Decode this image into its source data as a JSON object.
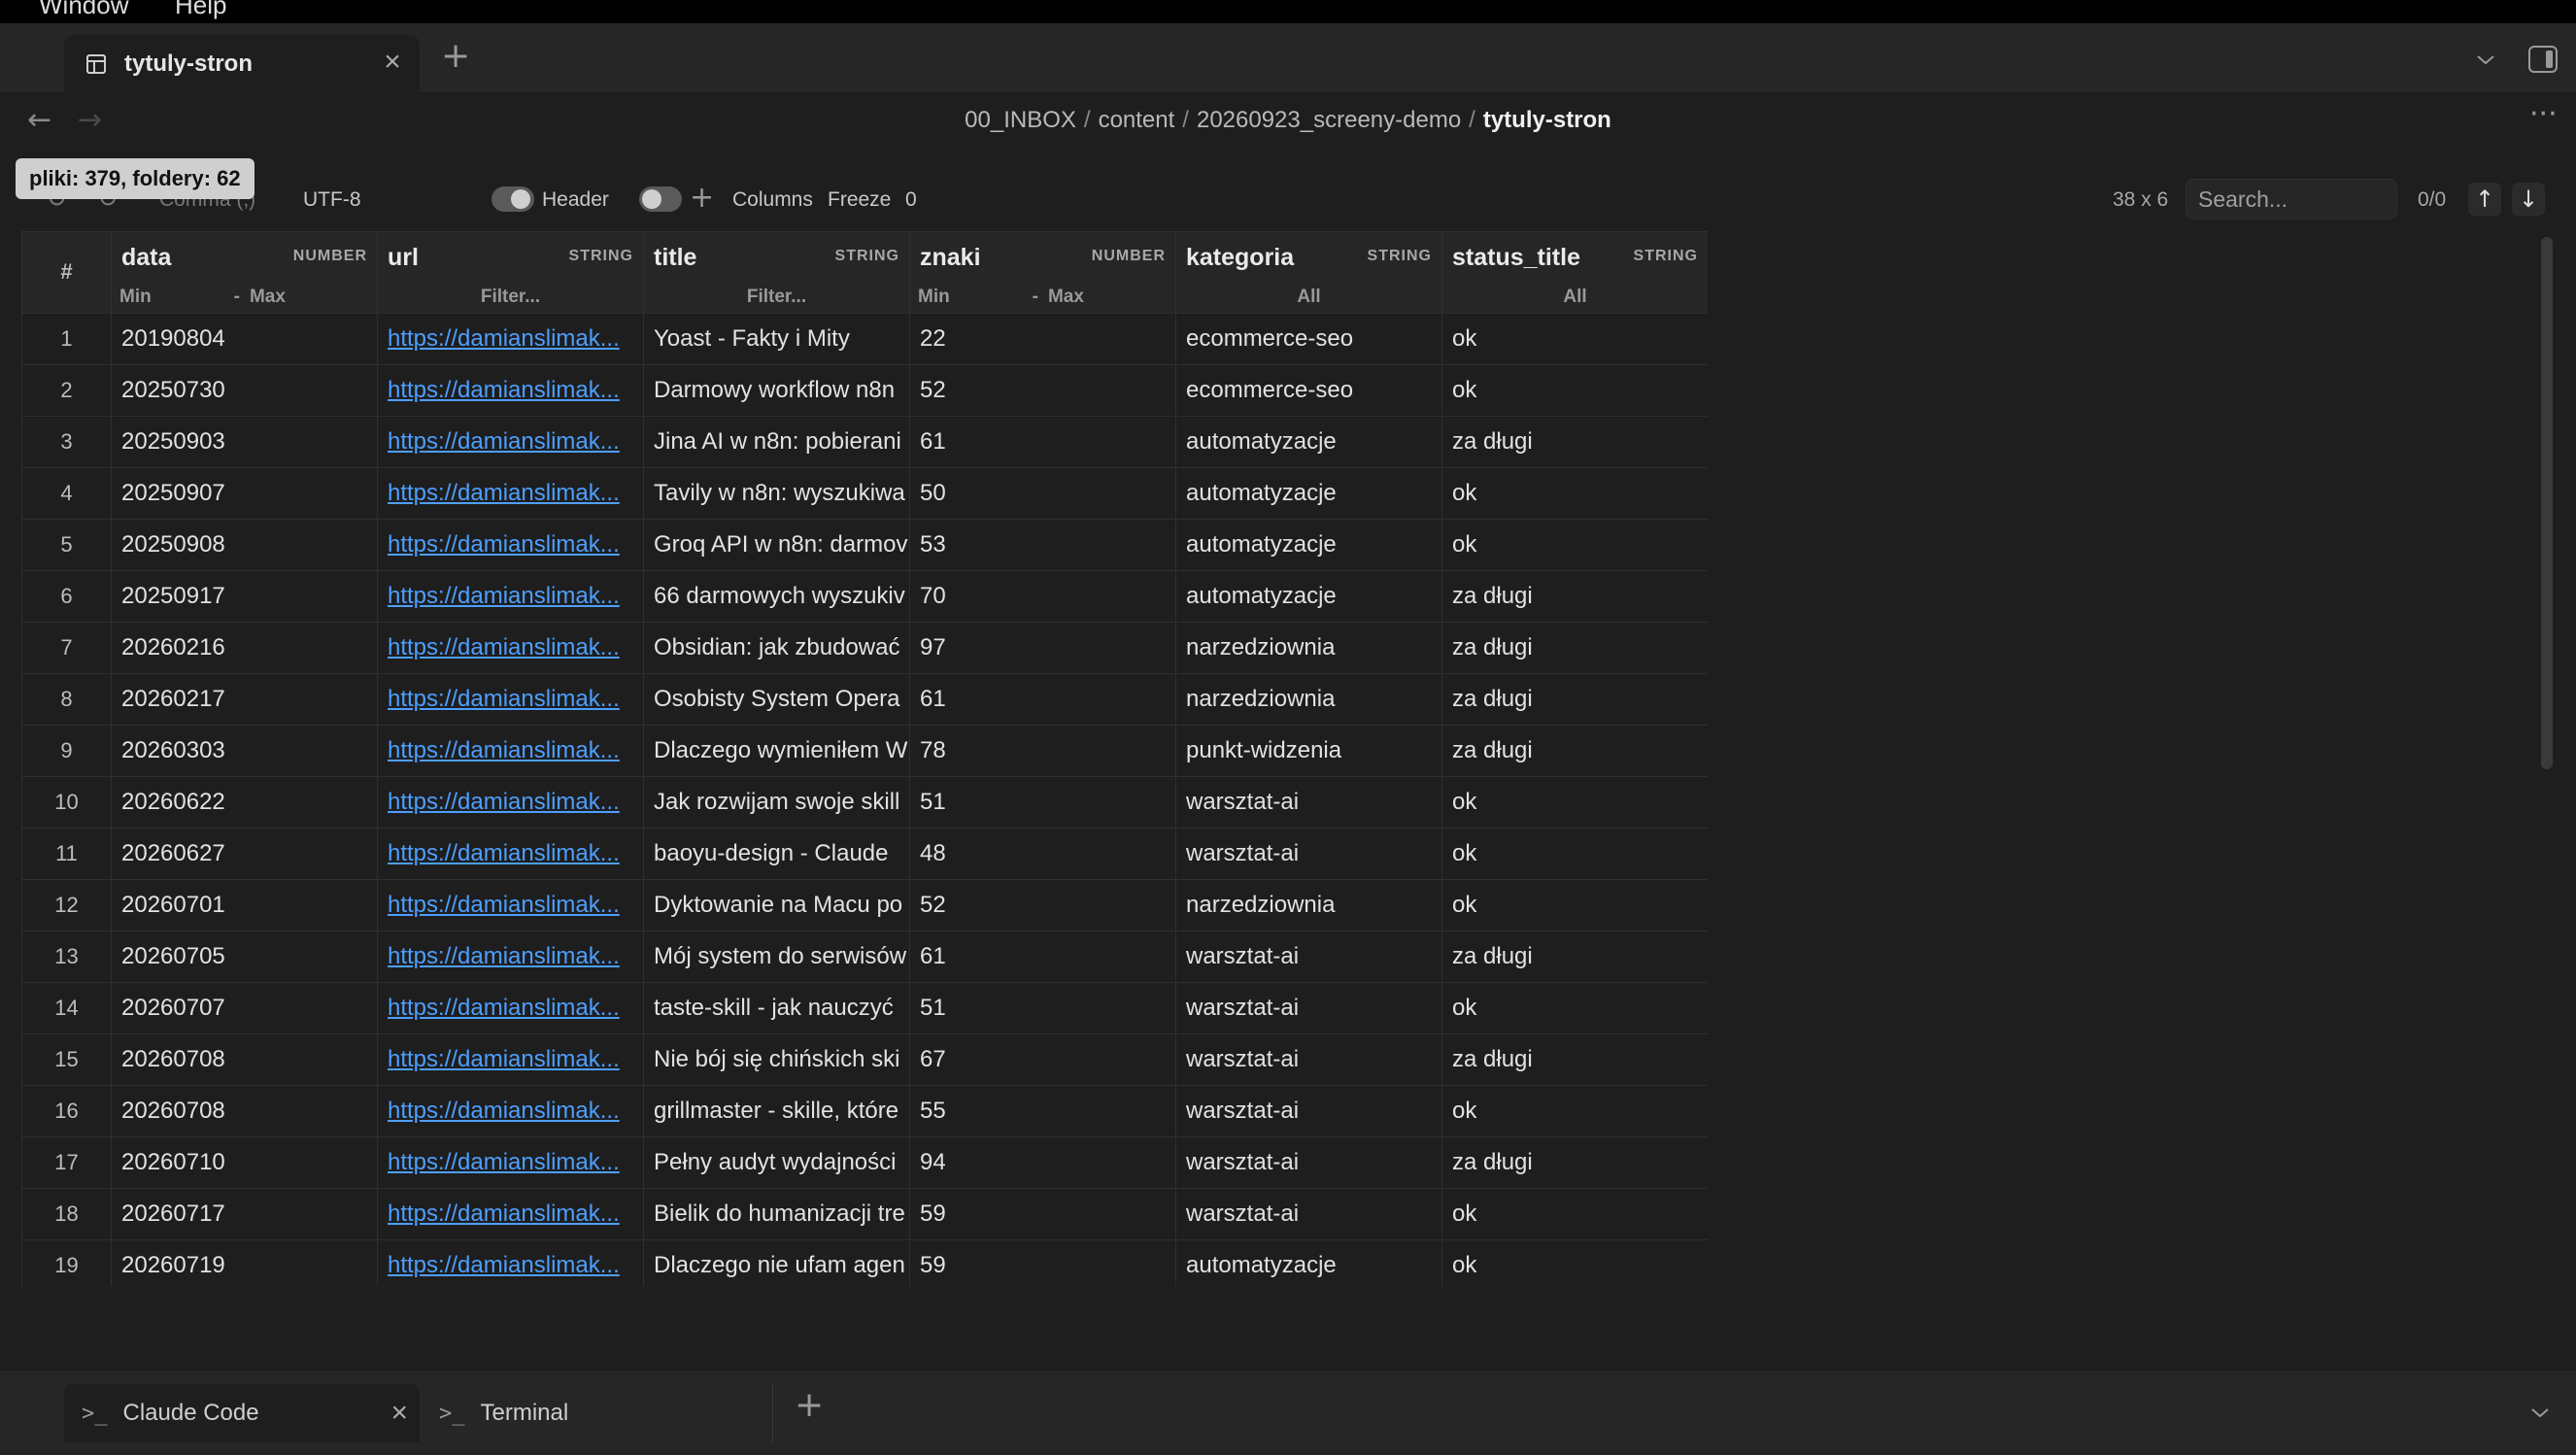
{
  "menubar": {
    "items": [
      "Window",
      "Help"
    ]
  },
  "tabs": [
    {
      "label": "tytuly-stron",
      "active": true
    }
  ],
  "breadcrumb": {
    "parts": [
      "00_INBOX",
      "content",
      "20260923_screeny-demo"
    ],
    "current": "tytuly-stron",
    "separator": "/"
  },
  "tooltip": {
    "text": "pliki: 379, foldery: 62"
  },
  "toolbar": {
    "delimiter": "Comma (,)",
    "encoding": "UTF-8",
    "header_label": "Header",
    "columns_label": "Columns",
    "freeze_label": "Freeze",
    "freeze_value": "0",
    "dimensions": "38 x 6",
    "search_placeholder": "Search...",
    "match_count": "0/0"
  },
  "table": {
    "index_header": "#",
    "columns": [
      {
        "name": "data",
        "type": "NUMBER",
        "filter": "range",
        "min": "Min",
        "dash": "-",
        "max": "Max"
      },
      {
        "name": "url",
        "type": "STRING",
        "filter": "text",
        "placeholder": "Filter..."
      },
      {
        "name": "title",
        "type": "STRING",
        "filter": "text",
        "placeholder": "Filter..."
      },
      {
        "name": "znaki",
        "type": "NUMBER",
        "filter": "range",
        "min": "Min",
        "dash": "-",
        "max": "Max"
      },
      {
        "name": "kategoria",
        "type": "STRING",
        "filter": "select",
        "value": "All"
      },
      {
        "name": "status_title",
        "type": "STRING",
        "filter": "select",
        "value": "All"
      }
    ],
    "rows": [
      {
        "i": "1",
        "data": "20190804",
        "url": "https://damianslimak...",
        "title": "Yoast - Fakty i Mity",
        "znaki": "22",
        "kategoria": "ecommerce-seo",
        "status": "ok"
      },
      {
        "i": "2",
        "data": "20250730",
        "url": "https://damianslimak...",
        "title": "Darmowy workflow n8n",
        "znaki": "52",
        "kategoria": "ecommerce-seo",
        "status": "ok"
      },
      {
        "i": "3",
        "data": "20250903",
        "url": "https://damianslimak...",
        "title": "Jina AI w n8n: pobierani",
        "znaki": "61",
        "kategoria": "automatyzacje",
        "status": "za długi"
      },
      {
        "i": "4",
        "data": "20250907",
        "url": "https://damianslimak...",
        "title": "Tavily w n8n: wyszukiwa",
        "znaki": "50",
        "kategoria": "automatyzacje",
        "status": "ok"
      },
      {
        "i": "5",
        "data": "20250908",
        "url": "https://damianslimak...",
        "title": "Groq API w n8n: darmov",
        "znaki": "53",
        "kategoria": "automatyzacje",
        "status": "ok"
      },
      {
        "i": "6",
        "data": "20250917",
        "url": "https://damianslimak...",
        "title": "66 darmowych wyszukiv",
        "znaki": "70",
        "kategoria": "automatyzacje",
        "status": "za długi"
      },
      {
        "i": "7",
        "data": "20260216",
        "url": "https://damianslimak...",
        "title": "Obsidian: jak zbudować",
        "znaki": "97",
        "kategoria": "narzedziownia",
        "status": "za długi"
      },
      {
        "i": "8",
        "data": "20260217",
        "url": "https://damianslimak...",
        "title": "Osobisty System Opera",
        "znaki": "61",
        "kategoria": "narzedziownia",
        "status": "za długi"
      },
      {
        "i": "9",
        "data": "20260303",
        "url": "https://damianslimak...",
        "title": "Dlaczego wymieniłem W",
        "znaki": "78",
        "kategoria": "punkt-widzenia",
        "status": "za długi"
      },
      {
        "i": "10",
        "data": "20260622",
        "url": "https://damianslimak...",
        "title": "Jak rozwijam swoje skill",
        "znaki": "51",
        "kategoria": "warsztat-ai",
        "status": "ok"
      },
      {
        "i": "11",
        "data": "20260627",
        "url": "https://damianslimak...",
        "title": "baoyu-design - Claude",
        "znaki": "48",
        "kategoria": "warsztat-ai",
        "status": "ok"
      },
      {
        "i": "12",
        "data": "20260701",
        "url": "https://damianslimak...",
        "title": "Dyktowanie na Macu po",
        "znaki": "52",
        "kategoria": "narzedziownia",
        "status": "ok"
      },
      {
        "i": "13",
        "data": "20260705",
        "url": "https://damianslimak...",
        "title": "Mój system do serwisów",
        "znaki": "61",
        "kategoria": "warsztat-ai",
        "status": "za długi"
      },
      {
        "i": "14",
        "data": "20260707",
        "url": "https://damianslimak...",
        "title": "taste-skill - jak nauczyć",
        "znaki": "51",
        "kategoria": "warsztat-ai",
        "status": "ok"
      },
      {
        "i": "15",
        "data": "20260708",
        "url": "https://damianslimak...",
        "title": "Nie bój się chińskich ski",
        "znaki": "67",
        "kategoria": "warsztat-ai",
        "status": "za długi"
      },
      {
        "i": "16",
        "data": "20260708",
        "url": "https://damianslimak...",
        "title": "grillmaster - skille, które",
        "znaki": "55",
        "kategoria": "warsztat-ai",
        "status": "ok"
      },
      {
        "i": "17",
        "data": "20260710",
        "url": "https://damianslimak...",
        "title": "Pełny audyt wydajności",
        "znaki": "94",
        "kategoria": "warsztat-ai",
        "status": "za długi"
      },
      {
        "i": "18",
        "data": "20260717",
        "url": "https://damianslimak...",
        "title": "Bielik do humanizacji tre",
        "znaki": "59",
        "kategoria": "warsztat-ai",
        "status": "ok"
      },
      {
        "i": "19",
        "data": "20260719",
        "url": "https://damianslimak...",
        "title": "Dlaczego nie ufam agen",
        "znaki": "59",
        "kategoria": "automatyzacje",
        "status": "ok"
      }
    ]
  },
  "terminal_tabs": [
    {
      "label": "Claude Code",
      "active": true
    },
    {
      "label": "Terminal",
      "active": false
    }
  ],
  "colors": {
    "link": "#4d9fff",
    "background": "#1e1e1e",
    "header": "#262626"
  }
}
